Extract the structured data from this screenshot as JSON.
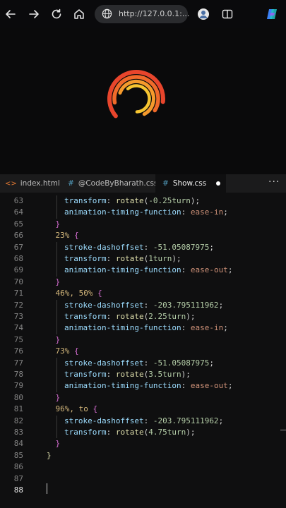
{
  "browser": {
    "url": "http://127.0.0.1:...",
    "icons": [
      "back-arrow-icon",
      "forward-arrow-icon",
      "reload-icon",
      "home-icon",
      "globe-icon",
      "profile-avatar-icon",
      "split-view-icon",
      "copilot-icon"
    ]
  },
  "tabs": [
    {
      "icon": "<>",
      "label": "index.html",
      "active": false
    },
    {
      "icon": "#",
      "label": "@CodeByBharath.css",
      "active": false
    },
    {
      "icon": "#",
      "label": "Show.css",
      "active": true
    }
  ],
  "more_label": "···",
  "colors": {
    "prop": "#9cdcfe",
    "num": "#b5cea8",
    "fn": "#dcdcaa",
    "brace": "#da70d6",
    "sel": "#d7ba7d",
    "kw": "#ce9178",
    "text": "#d4d4d4"
  },
  "lines": [
    {
      "n": "63",
      "indent": 2,
      "tokens": [
        [
          "prop",
          "transform"
        ],
        [
          "text",
          ": "
        ],
        [
          "fn",
          "rotate"
        ],
        [
          "text",
          "("
        ],
        [
          "num",
          "-0.25turn"
        ],
        [
          "text",
          ");"
        ]
      ]
    },
    {
      "n": "64",
      "indent": 2,
      "tokens": [
        [
          "prop",
          "animation-timing-function"
        ],
        [
          "text",
          ": "
        ],
        [
          "kw",
          "ease-in"
        ],
        [
          "text",
          ";"
        ]
      ]
    },
    {
      "n": "65",
      "indent": 1,
      "tokens": [
        [
          "brace",
          "}"
        ]
      ]
    },
    {
      "n": "66",
      "indent": 1,
      "tokens": [
        [
          "sel",
          "23%"
        ],
        [
          "text",
          " "
        ],
        [
          "brace",
          "{"
        ]
      ]
    },
    {
      "n": "67",
      "indent": 2,
      "tokens": [
        [
          "prop",
          "stroke-dashoffset"
        ],
        [
          "text",
          ": "
        ],
        [
          "num",
          "-51.05087975"
        ],
        [
          "text",
          ";"
        ]
      ]
    },
    {
      "n": "68",
      "indent": 2,
      "tokens": [
        [
          "prop",
          "transform"
        ],
        [
          "text",
          ": "
        ],
        [
          "fn",
          "rotate"
        ],
        [
          "text",
          "("
        ],
        [
          "num",
          "1turn"
        ],
        [
          "text",
          ");"
        ]
      ]
    },
    {
      "n": "69",
      "indent": 2,
      "tokens": [
        [
          "prop",
          "animation-timing-function"
        ],
        [
          "text",
          ": "
        ],
        [
          "kw",
          "ease-out"
        ],
        [
          "text",
          ";"
        ]
      ]
    },
    {
      "n": "70",
      "indent": 1,
      "tokens": [
        [
          "brace",
          "}"
        ]
      ]
    },
    {
      "n": "71",
      "indent": 1,
      "tokens": [
        [
          "sel",
          "46%, 50%"
        ],
        [
          "text",
          " "
        ],
        [
          "brace",
          "{"
        ]
      ]
    },
    {
      "n": "72",
      "indent": 2,
      "tokens": [
        [
          "prop",
          "stroke-dashoffset"
        ],
        [
          "text",
          ": "
        ],
        [
          "num",
          "-203.795111962"
        ],
        [
          "text",
          ";"
        ]
      ]
    },
    {
      "n": "73",
      "indent": 2,
      "tokens": [
        [
          "prop",
          "transform"
        ],
        [
          "text",
          ": "
        ],
        [
          "fn",
          "rotate"
        ],
        [
          "text",
          "("
        ],
        [
          "num",
          "2.25turn"
        ],
        [
          "text",
          ");"
        ]
      ]
    },
    {
      "n": "74",
      "indent": 2,
      "tokens": [
        [
          "prop",
          "animation-timing-function"
        ],
        [
          "text",
          ": "
        ],
        [
          "kw",
          "ease-in"
        ],
        [
          "text",
          ";"
        ]
      ]
    },
    {
      "n": "75",
      "indent": 1,
      "tokens": [
        [
          "brace",
          "}"
        ]
      ]
    },
    {
      "n": "76",
      "indent": 1,
      "tokens": [
        [
          "sel",
          "73%"
        ],
        [
          "text",
          " "
        ],
        [
          "brace",
          "{"
        ]
      ]
    },
    {
      "n": "77",
      "indent": 2,
      "tokens": [
        [
          "prop",
          "stroke-dashoffset"
        ],
        [
          "text",
          ": "
        ],
        [
          "num",
          "-51.05087975"
        ],
        [
          "text",
          ";"
        ]
      ]
    },
    {
      "n": "78",
      "indent": 2,
      "tokens": [
        [
          "prop",
          "transform"
        ],
        [
          "text",
          ": "
        ],
        [
          "fn",
          "rotate"
        ],
        [
          "text",
          "("
        ],
        [
          "num",
          "3.5turn"
        ],
        [
          "text",
          ");"
        ]
      ]
    },
    {
      "n": "79",
      "indent": 2,
      "tokens": [
        [
          "prop",
          "animation-timing-function"
        ],
        [
          "text",
          ": "
        ],
        [
          "kw",
          "ease-out"
        ],
        [
          "text",
          ";"
        ]
      ]
    },
    {
      "n": "80",
      "indent": 1,
      "tokens": [
        [
          "brace",
          "}"
        ]
      ]
    },
    {
      "n": "81",
      "indent": 1,
      "tokens": [
        [
          "sel",
          "96%, to"
        ],
        [
          "text",
          " "
        ],
        [
          "brace",
          "{"
        ]
      ]
    },
    {
      "n": "82",
      "indent": 2,
      "tokens": [
        [
          "prop",
          "stroke-dashoffset"
        ],
        [
          "text",
          ": "
        ],
        [
          "num",
          "-203.795111962"
        ],
        [
          "text",
          ";"
        ]
      ]
    },
    {
      "n": "83",
      "indent": 2,
      "tokens": [
        [
          "prop",
          "transform"
        ],
        [
          "text",
          ": "
        ],
        [
          "fn",
          "rotate"
        ],
        [
          "text",
          "("
        ],
        [
          "num",
          "4.75turn"
        ],
        [
          "text",
          ");"
        ]
      ]
    },
    {
      "n": "84",
      "indent": 1,
      "tokens": [
        [
          "brace",
          "}"
        ]
      ]
    },
    {
      "n": "85",
      "indent": 0,
      "tokens": [
        [
          "fn",
          "}"
        ]
      ]
    },
    {
      "n": "86",
      "indent": 0,
      "tokens": []
    },
    {
      "n": "87",
      "indent": 0,
      "tokens": []
    },
    {
      "n": "88",
      "indent": 0,
      "tokens": [],
      "current": true
    }
  ]
}
